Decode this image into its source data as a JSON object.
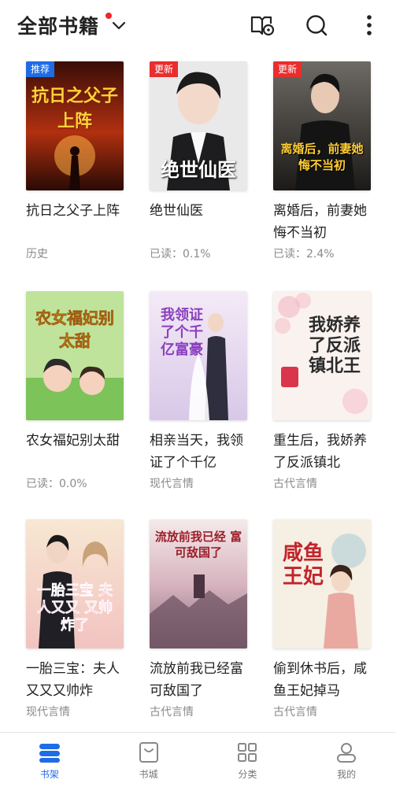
{
  "header": {
    "title": "全部书籍",
    "accent": "#1e6ce6",
    "dot_color": "#f0252b"
  },
  "books": [
    {
      "name": "抗日之父子上阵",
      "meta": "历史",
      "badge": "推荐",
      "badge_color": "blue",
      "cover_text": "抗日之父子上阵"
    },
    {
      "name": "绝世仙医",
      "meta": "已读：0.1%",
      "badge": "更新",
      "badge_color": "red",
      "cover_text": "绝世仙医"
    },
    {
      "name": "离婚后，前妻她悔不当初",
      "meta": "已读：2.4%",
      "badge": "更新",
      "badge_color": "red",
      "cover_text": "离婚后，前妻她 悔不当初"
    },
    {
      "name": "农女福妃别太甜",
      "meta": "已读：0.0%",
      "badge": "",
      "badge_color": "",
      "cover_text": "农女福妃别太甜"
    },
    {
      "name": "相亲当天，我领证了个千亿",
      "meta": "现代言情",
      "badge": "",
      "badge_color": "",
      "cover_text": "我领证了个千亿富豪"
    },
    {
      "name": "重生后，我娇养了反派镇北",
      "meta": "古代言情",
      "badge": "",
      "badge_color": "",
      "cover_text": "我娇养了反派镇北王"
    },
    {
      "name": "一胎三宝：夫人又又又帅炸",
      "meta": "现代言情",
      "badge": "",
      "badge_color": "",
      "cover_text": "一胎三宝 夫人又又 又帅炸了"
    },
    {
      "name": "流放前我已经富可敌国了",
      "meta": "古代言情",
      "badge": "",
      "badge_color": "",
      "cover_text": "流放前我已经 富可敌国了"
    },
    {
      "name": "偷到休书后，咸鱼王妃掉马",
      "meta": "古代言情",
      "badge": "",
      "badge_color": "",
      "cover_text": "咸鱼王妃"
    }
  ],
  "bottom_nav": [
    {
      "label": "书架",
      "icon": "bookshelf-icon",
      "active": true
    },
    {
      "label": "书城",
      "icon": "bookstore-icon",
      "active": false
    },
    {
      "label": "分类",
      "icon": "category-icon",
      "active": false
    },
    {
      "label": "我的",
      "icon": "profile-icon",
      "active": false
    }
  ],
  "header_icons": [
    "book-manage-icon",
    "search-icon",
    "more-icon"
  ]
}
